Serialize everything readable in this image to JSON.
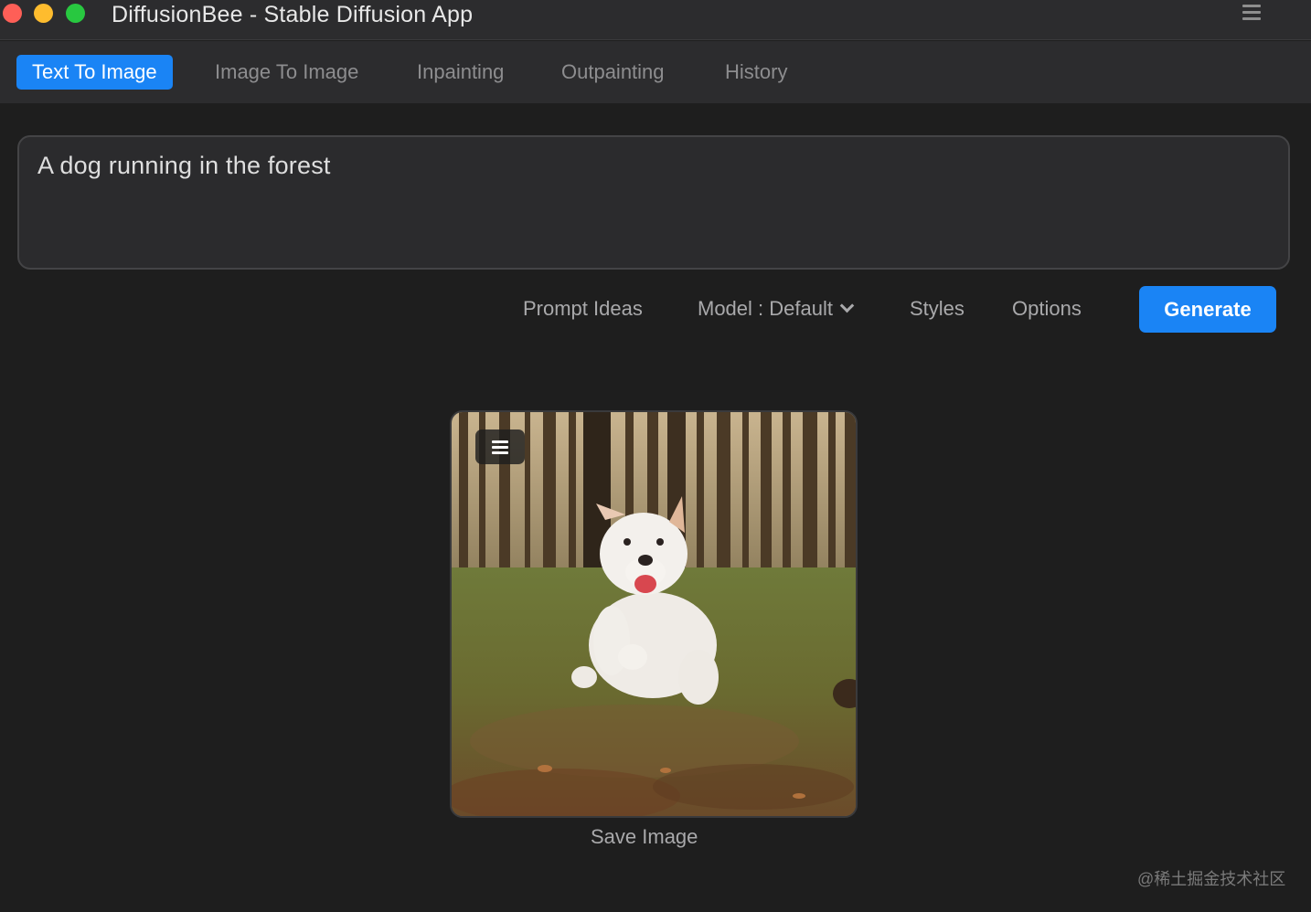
{
  "window": {
    "title": "DiffusionBee - Stable Diffusion App",
    "traffic_lights": [
      "close",
      "minimize",
      "maximize"
    ]
  },
  "tabs": [
    {
      "label": "Text To Image",
      "active": true
    },
    {
      "label": "Image To Image",
      "active": false
    },
    {
      "label": "Inpainting",
      "active": false
    },
    {
      "label": "Outpainting",
      "active": false
    },
    {
      "label": "History",
      "active": false
    }
  ],
  "prompt": {
    "value": "A dog running in the forest"
  },
  "actions": {
    "prompt_ideas": "Prompt Ideas",
    "model": "Model : Default",
    "styles": "Styles",
    "options": "Options",
    "generate": "Generate"
  },
  "result": {
    "image_icon": "hamburger-menu-icon",
    "save_label": "Save Image"
  },
  "watermark": "@稀土掘金技术社区",
  "colors": {
    "accent": "#1a84f5",
    "background": "#1e1e1e",
    "titlebar": "#2c2c2e"
  }
}
